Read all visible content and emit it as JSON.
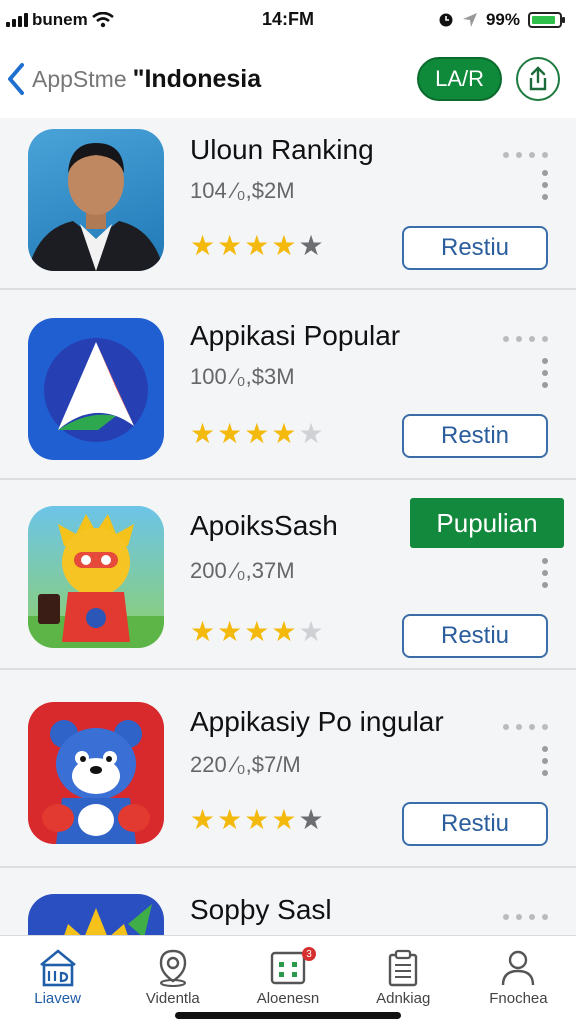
{
  "status_bar": {
    "carrier": "bunem",
    "time": "14:FM",
    "battery": "99%",
    "battery_level": 0.9
  },
  "header": {
    "back_label": "AppStme",
    "title": "\"Indonesia",
    "pill_label": "LA/R",
    "share_icon": "share-icon"
  },
  "apps": [
    {
      "name": "Uloun Ranking",
      "meta": "104 ⁄₀,$2M",
      "rating": 4,
      "button": "Restiu"
    },
    {
      "name": "Appikasi Popular",
      "meta": "100 ⁄₀,$3M",
      "rating": 4,
      "button": "Restin"
    },
    {
      "name": "ApoiksSash",
      "meta": "200 ⁄₀,37M",
      "rating": 4,
      "button": "Restiu",
      "badge": "Pupulian"
    },
    {
      "name": "Appikasiy Po ingular",
      "meta": "220 ⁄₀,$7/M",
      "rating": 4,
      "button": "Restiu"
    },
    {
      "name": "Sopþy Sasl"
    }
  ],
  "tabs": [
    {
      "label": "Liavew",
      "icon": "store-icon",
      "active": true
    },
    {
      "label": "Videntla",
      "icon": "location-pin-icon",
      "active": false
    },
    {
      "label": "Aloenesn",
      "icon": "apps-grid-icon",
      "active": false,
      "badge": "3"
    },
    {
      "label": "Adnkiag",
      "icon": "clipboard-icon",
      "active": false
    },
    {
      "label": "Fnochea",
      "icon": "person-icon",
      "active": false
    }
  ]
}
